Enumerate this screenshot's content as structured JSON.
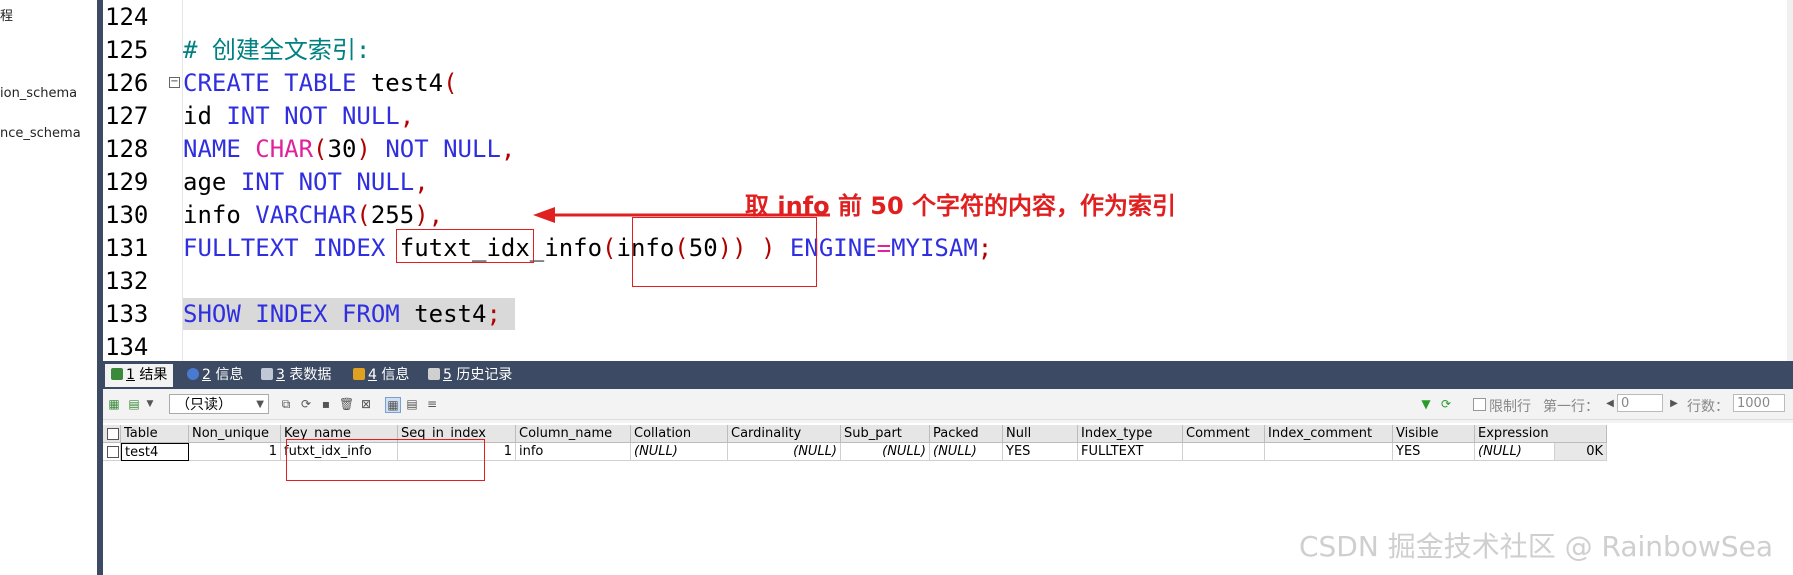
{
  "tree": {
    "items": [
      "程",
      "ion_schema",
      "nce_schema"
    ]
  },
  "editor": {
    "lines": [
      {
        "num": "124"
      },
      {
        "num": "125",
        "comment": "# 创建全文索引:"
      },
      {
        "num": "126",
        "kw1": "CREATE TABLE",
        "name": "test4",
        "open": "("
      },
      {
        "num": "127",
        "col": "id",
        "kw": "INT NOT NULL",
        "tail": ","
      },
      {
        "num": "128",
        "col": "NAME",
        "fn": "CHAR",
        "open": "(",
        "n": "30",
        "close": ")",
        "kw": "NOT NULL",
        "tail": ","
      },
      {
        "num": "129",
        "col": "age",
        "kw": "INT NOT NULL",
        "tail": ","
      },
      {
        "num": "130",
        "col": "info",
        "kw": "VARCHAR",
        "open": "(",
        "n": "255",
        "close": ")",
        "tail": ","
      },
      {
        "num": "131",
        "kw1": "FULLTEXT INDEX",
        "idx": "futxt_idx_info",
        "open": "(",
        "col": "info",
        "open2": "(",
        "n": "50",
        "close": "))",
        "close2": ")",
        "kw2": "ENGINE",
        "eq": "=",
        "engine": "MYISAM",
        "semi": ";"
      },
      {
        "num": "132"
      },
      {
        "num": "133",
        "kw": "SHOW INDEX FROM",
        "name": "test4",
        "semi": ";"
      },
      {
        "num": "134"
      }
    ],
    "annotation": "取 info 前 50 个字符的内容，作为索引"
  },
  "tabs": [
    {
      "num": "1",
      "label": "结果"
    },
    {
      "num": "2",
      "label": "信息"
    },
    {
      "num": "3",
      "label": "表数据"
    },
    {
      "num": "4",
      "label": "信息"
    },
    {
      "num": "5",
      "label": "历史记录"
    }
  ],
  "toolbar": {
    "readonly": "（只读）",
    "limit_label": "限制行",
    "first_row_label": "第一行：",
    "first_row_value": "0",
    "rows_label": "行数：",
    "rows_value": "1000"
  },
  "grid": {
    "columns": [
      "Table",
      "Non_unique",
      "Key_name",
      "Seq_in_index",
      "Column_name",
      "Collation",
      "Cardinality",
      "Sub_part",
      "Packed",
      "Null",
      "Index_type",
      "Comment",
      "Index_comment",
      "Visible",
      "Expression"
    ],
    "row": [
      "test4",
      "1",
      "futxt_idx_info",
      "1",
      "info",
      "(NULL)",
      "(NULL)",
      "(NULL)",
      "(NULL)",
      "YES",
      "FULLTEXT",
      "",
      "",
      "YES",
      "(NULL)"
    ],
    "size": "0K"
  },
  "watermark": "CSDN 掘金技术社区 @ RainbowSea"
}
